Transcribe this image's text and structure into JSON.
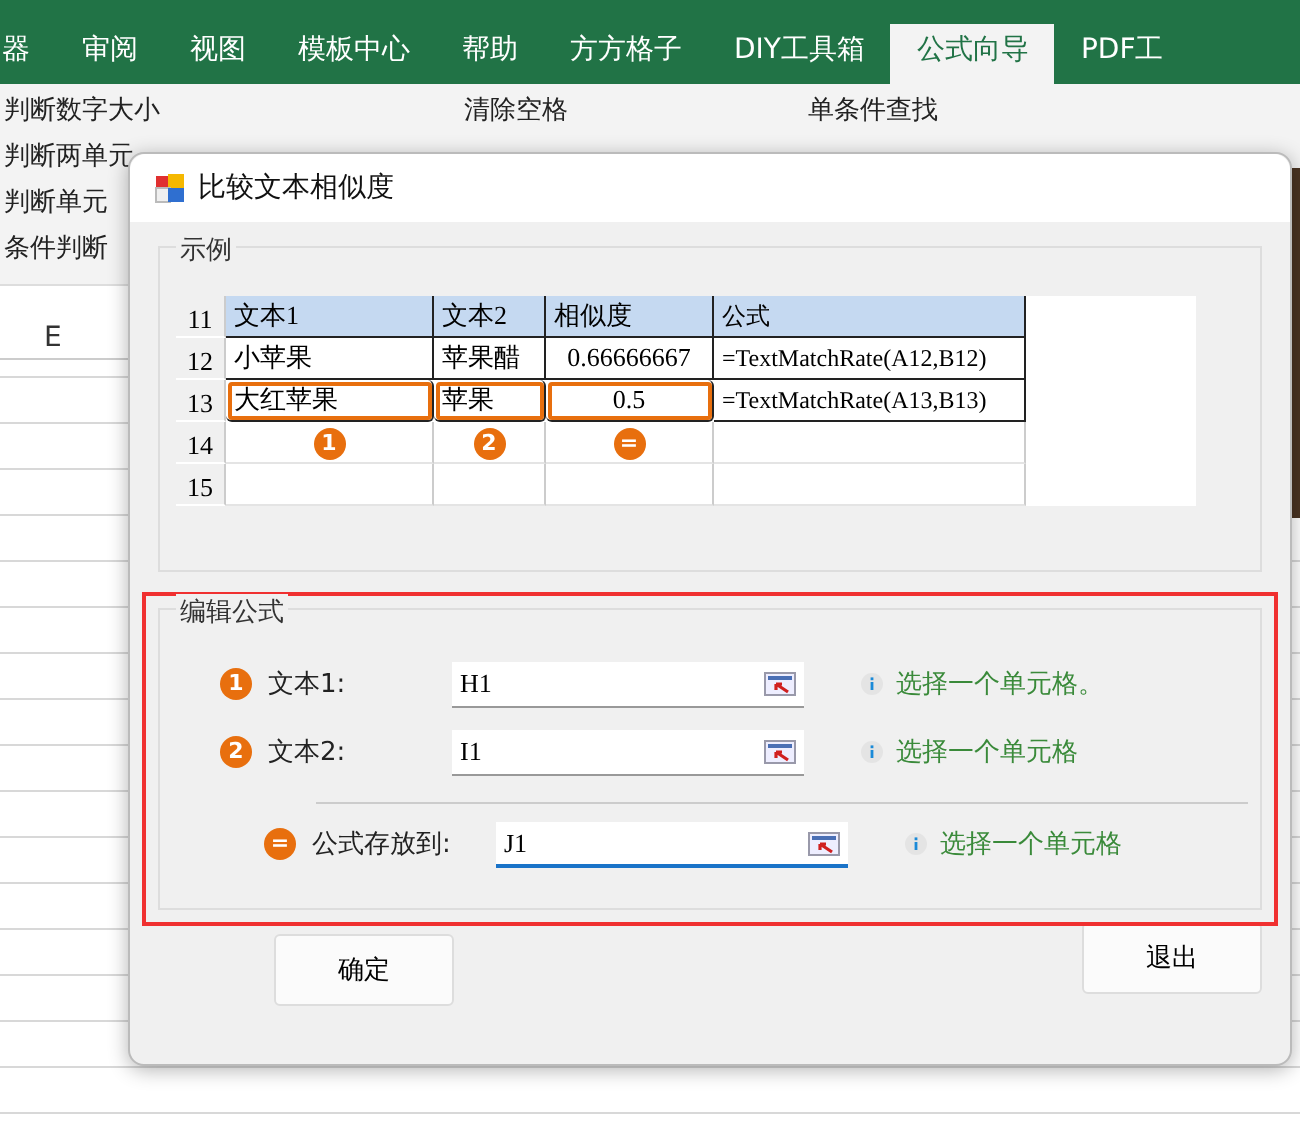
{
  "ribbon": {
    "tabs": [
      {
        "label": "器",
        "selected": false
      },
      {
        "label": "审阅",
        "selected": false
      },
      {
        "label": "视图",
        "selected": false
      },
      {
        "label": "模板中心",
        "selected": false
      },
      {
        "label": "帮助",
        "selected": false
      },
      {
        "label": "方方格子",
        "selected": false
      },
      {
        "label": "DIY工具箱",
        "selected": false
      },
      {
        "label": "公式向导",
        "selected": true
      },
      {
        "label": "PDF工",
        "selected": false
      }
    ],
    "left_commands": [
      "判断数字大小",
      "判断两单元",
      "判断单元",
      "条件判断"
    ],
    "commands": [
      "清除空格",
      "单条件查找"
    ]
  },
  "sheet": {
    "column_header": "E"
  },
  "dialog": {
    "title": "比较文本相似度",
    "example": {
      "title": "示例",
      "rows": [
        {
          "number": "11",
          "header": true,
          "cells": [
            {
              "text": "文本1",
              "highlighted": false
            },
            {
              "text": "文本2",
              "highlighted": false
            },
            {
              "text": "相似度",
              "highlighted": false
            },
            {
              "text": "公式",
              "highlighted": false
            }
          ]
        },
        {
          "number": "12",
          "header": false,
          "cells": [
            {
              "text": "小苹果",
              "highlighted": false
            },
            {
              "text": "苹果醋",
              "highlighted": false
            },
            {
              "text": "0.66666667",
              "highlighted": false
            },
            {
              "text": "=TextMatchRate(A12,B12)",
              "highlighted": false
            }
          ]
        },
        {
          "number": "13",
          "header": false,
          "cells": [
            {
              "text": "大红苹果",
              "highlighted": true
            },
            {
              "text": "苹果",
              "highlighted": true
            },
            {
              "text": "0.5",
              "highlighted": true
            },
            {
              "text": "=TextMatchRate(A13,B13)",
              "highlighted": false
            }
          ]
        },
        {
          "number": "14",
          "header": false,
          "cells": [
            {
              "text": "",
              "badge": "1",
              "highlighted": false
            },
            {
              "text": "",
              "badge": "2",
              "highlighted": false
            },
            {
              "text": "",
              "badge": "=",
              "highlighted": false
            },
            {
              "text": "",
              "highlighted": false
            }
          ]
        },
        {
          "number": "15",
          "header": false,
          "cells": [
            {
              "text": "",
              "highlighted": false
            },
            {
              "text": "",
              "highlighted": false
            },
            {
              "text": "",
              "highlighted": false
            },
            {
              "text": "",
              "highlighted": false
            }
          ]
        }
      ]
    },
    "edit": {
      "title": "编辑公式",
      "highlighted": true,
      "fields": [
        {
          "badge": "1",
          "label": "文本1:",
          "value": "H1",
          "hint": "选择一个单元格。",
          "focused": false
        },
        {
          "badge": "2",
          "label": "文本2:",
          "value": "I1",
          "hint": "选择一个单元格",
          "focused": false
        },
        {
          "badge": "=",
          "label": "公式存放到:",
          "value": "J1",
          "hint": "选择一个单元格",
          "focused": true
        }
      ]
    },
    "buttons": [
      "确定",
      "退出"
    ]
  }
}
